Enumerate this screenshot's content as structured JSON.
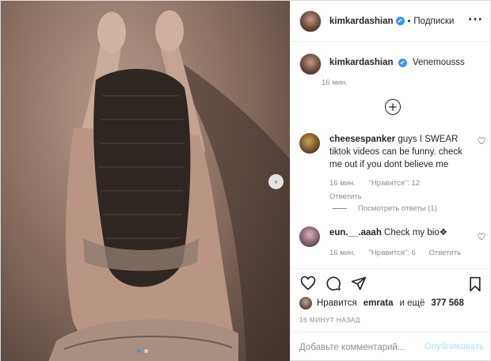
{
  "post": {
    "username": "kimkardashian",
    "verified_mark": "✔",
    "separator": "•",
    "follow_label": "Подписки",
    "more_label": "···"
  },
  "caption": {
    "username": "kimkardashian",
    "text": "Venemousss",
    "time": "16 мин."
  },
  "load_more_label": "+",
  "comments": [
    {
      "username": "cheesespanker",
      "text": "guys I SWEAR tiktok videos can be funny. check me out if you dont believe me",
      "time": "16 мин.",
      "likes": "\"Нравится\": 12",
      "reply": "Ответить"
    },
    {
      "username": "eun.__.aaah",
      "text": "Check my bio❖",
      "time": "16 мин.",
      "likes": "\"Нравится\": 6",
      "reply": "Ответить"
    }
  ],
  "view_replies": "Посмотреть ответы (1)",
  "likes": {
    "prefix": "Нравится",
    "name": "emrata",
    "middle": "и ещё",
    "count": "377 568"
  },
  "posted_time": "16 МИНУТ НАЗАД",
  "add_comment": {
    "placeholder": "Добавьте комментарий...",
    "publish_label": "Опубликовать"
  },
  "carousel": {
    "next_arrow": "›",
    "slides": 2,
    "active_slide": 1
  },
  "colors": {
    "accent": "#3897f0",
    "muted_text": "#8e8e8e",
    "publish_disabled": "#b2dffc"
  }
}
